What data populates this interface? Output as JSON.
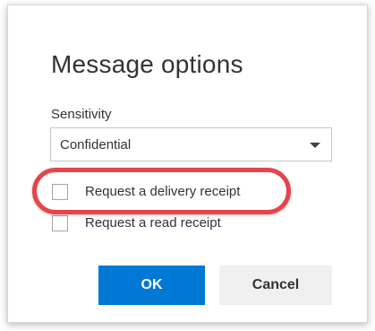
{
  "dialog": {
    "title": "Message options",
    "sensitivity": {
      "label": "Sensitivity",
      "selected": "Confidential"
    },
    "options": [
      {
        "label": "Request a delivery receipt",
        "checked": false,
        "highlighted": true
      },
      {
        "label": "Request a read receipt",
        "checked": false,
        "highlighted": false
      }
    ],
    "buttons": {
      "ok": "OK",
      "cancel": "Cancel"
    }
  },
  "colors": {
    "primary": "#0078d4",
    "highlight": "#e8434a",
    "secondary_button": "#f0f0f0"
  }
}
